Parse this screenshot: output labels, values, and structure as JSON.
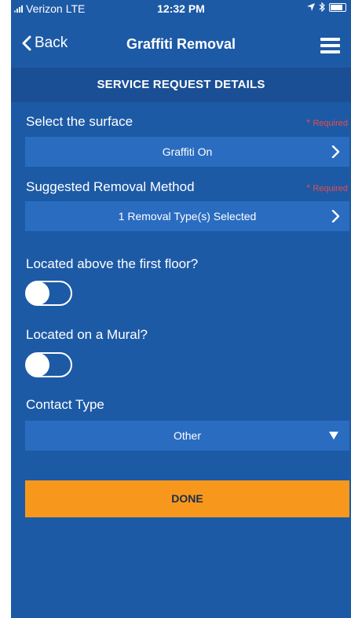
{
  "status_bar": {
    "carrier": "Verizon",
    "network": "LTE",
    "time": "12:32 PM"
  },
  "nav": {
    "back_label": "Back",
    "title": "Graffiti Removal"
  },
  "section_header": "SERVICE REQUEST DETAILS",
  "surface": {
    "label": "Select the surface",
    "required": "Required",
    "value": "Graffiti On"
  },
  "removal": {
    "label": "Suggested Removal Method",
    "required": "Required",
    "value": "1 Removal Type(s) Selected"
  },
  "above_first_floor": {
    "label": "Located above the first floor?",
    "on": false
  },
  "on_mural": {
    "label": "Located on a Mural?",
    "on": false
  },
  "contact_type": {
    "label": "Contact Type",
    "value": "Other"
  },
  "done_label": "DONE",
  "colors": {
    "background": "#1d5aa6",
    "row": "#2a6cc0",
    "header": "#1a4f95",
    "required": "#e84b4b",
    "done": "#f7981d"
  }
}
